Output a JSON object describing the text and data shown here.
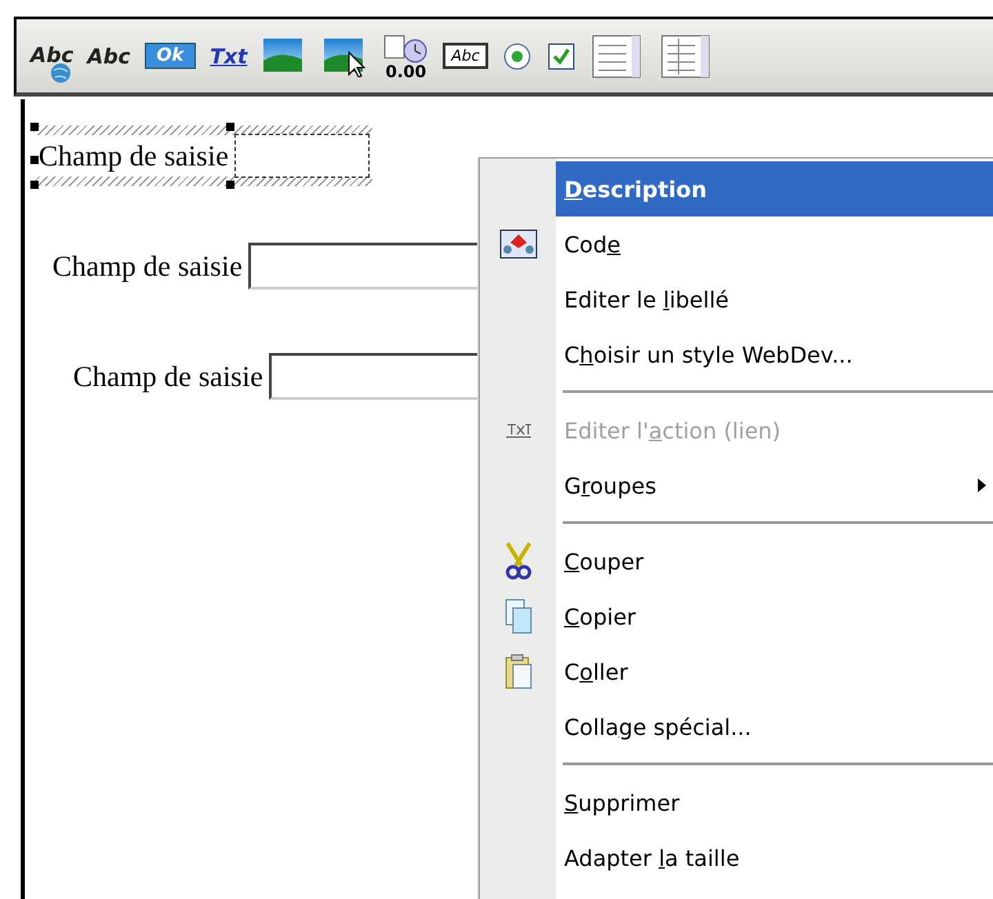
{
  "toolbar": [
    {
      "kind": "text-globe",
      "label": "Abc"
    },
    {
      "kind": "text-italic",
      "label": "Abc"
    },
    {
      "kind": "button",
      "label": "Ok"
    },
    {
      "kind": "link",
      "label": "Txt"
    },
    {
      "kind": "image"
    },
    {
      "kind": "image-pointer"
    },
    {
      "kind": "calendar",
      "label": "0.00"
    },
    {
      "kind": "field",
      "label": "Abc"
    },
    {
      "kind": "radio"
    },
    {
      "kind": "checkbox"
    },
    {
      "kind": "list"
    },
    {
      "kind": "table"
    }
  ],
  "fields": [
    {
      "label": "Champ de saisie",
      "selected": true
    },
    {
      "label": "Champ de saisie",
      "selected": false
    },
    {
      "label": "Champ de saisie",
      "selected": false
    }
  ],
  "context_menu": [
    {
      "kind": "item",
      "key": "D",
      "after": "escription",
      "selected": true,
      "disabled": false
    },
    {
      "kind": "item",
      "before": "Cod",
      "key": "e",
      "selected": false,
      "disabled": false
    },
    {
      "kind": "item",
      "before": "Editer le ",
      "key": "l",
      "after": "ibellé",
      "selected": false,
      "disabled": false
    },
    {
      "kind": "item",
      "before": "C",
      "key": "h",
      "after": "oisir un style WebDev...",
      "selected": false,
      "disabled": false
    },
    {
      "kind": "separator"
    },
    {
      "kind": "item",
      "before": "Editer l'",
      "key": "a",
      "after": "ction (lien)",
      "selected": false,
      "disabled": true
    },
    {
      "kind": "submenu",
      "before": "G",
      "key": "r",
      "after": "oupes",
      "selected": false,
      "disabled": false
    },
    {
      "kind": "separator"
    },
    {
      "kind": "item",
      "key": "C",
      "after": "ouper",
      "selected": false,
      "disabled": false
    },
    {
      "kind": "item",
      "key": "C",
      "after": "opier",
      "selected": false,
      "disabled": false
    },
    {
      "kind": "item",
      "before": "C",
      "key": "o",
      "after": "ller",
      "selected": false,
      "disabled": false
    },
    {
      "kind": "item",
      "before": "Colla",
      "key": "g",
      "after": "e spécial...",
      "selected": false,
      "disabled": false
    },
    {
      "kind": "separator"
    },
    {
      "kind": "item",
      "key": "S",
      "after": "upprimer",
      "selected": false,
      "disabled": false
    },
    {
      "kind": "item",
      "before": "Adapter ",
      "key": "l",
      "after": "a taille",
      "selected": false,
      "disabled": false
    }
  ]
}
